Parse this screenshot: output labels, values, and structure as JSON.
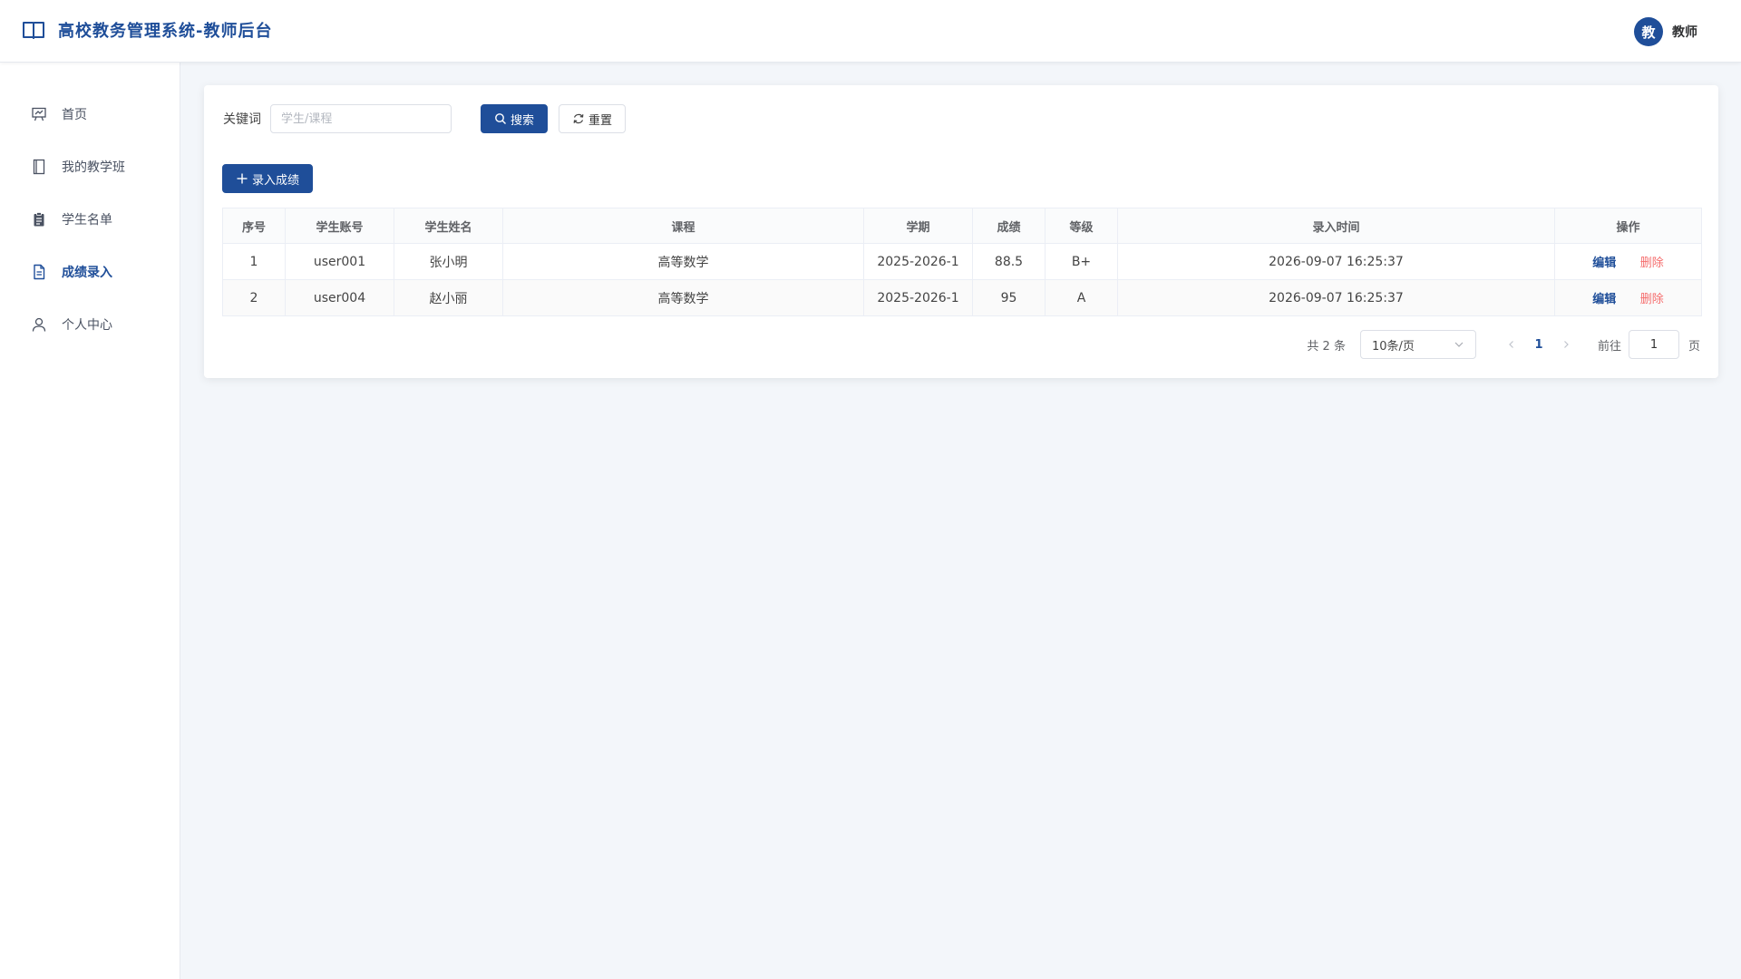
{
  "header": {
    "title": "高校教务管理系统-教师后台",
    "avatar_text": "教",
    "user_name": "教师"
  },
  "sidebar": {
    "items": [
      {
        "label": "首页",
        "icon": "presentation-board-icon",
        "active": false
      },
      {
        "label": "我的教学班",
        "icon": "notebook-icon",
        "active": false
      },
      {
        "label": "学生名单",
        "icon": "clipboard-icon",
        "active": false
      },
      {
        "label": "成绩录入",
        "icon": "document-icon",
        "active": true
      },
      {
        "label": "个人中心",
        "icon": "user-icon",
        "active": false
      }
    ]
  },
  "search": {
    "label": "关键词",
    "placeholder": "学生/课程",
    "value": "",
    "search_button": "搜索",
    "reset_button": "重置"
  },
  "toolbar": {
    "add_button": "录入成绩"
  },
  "table": {
    "columns": [
      "序号",
      "学生账号",
      "学生姓名",
      "课程",
      "学期",
      "成绩",
      "等级",
      "录入时间",
      "操作"
    ],
    "rows": [
      {
        "index": "1",
        "account": "user001",
        "name": "张小明",
        "course": "高等数学",
        "term": "2025-2026-1",
        "score": "88.5",
        "grade": "B+",
        "time": "2026-09-07 16:25:37"
      },
      {
        "index": "2",
        "account": "user004",
        "name": "赵小丽",
        "course": "高等数学",
        "term": "2025-2026-1",
        "score": "95",
        "grade": "A",
        "time": "2026-09-07 16:25:37"
      }
    ],
    "edit_label": "编辑",
    "delete_label": "删除"
  },
  "pagination": {
    "total_text": "共 2 条",
    "page_size": "10条/页",
    "current_page": "1",
    "goto_label": "前往",
    "goto_value": "1",
    "page_suffix": "页"
  },
  "colors": {
    "primary": "#1f4e99",
    "danger": "#f56c6c",
    "background": "#f3f6fa"
  }
}
